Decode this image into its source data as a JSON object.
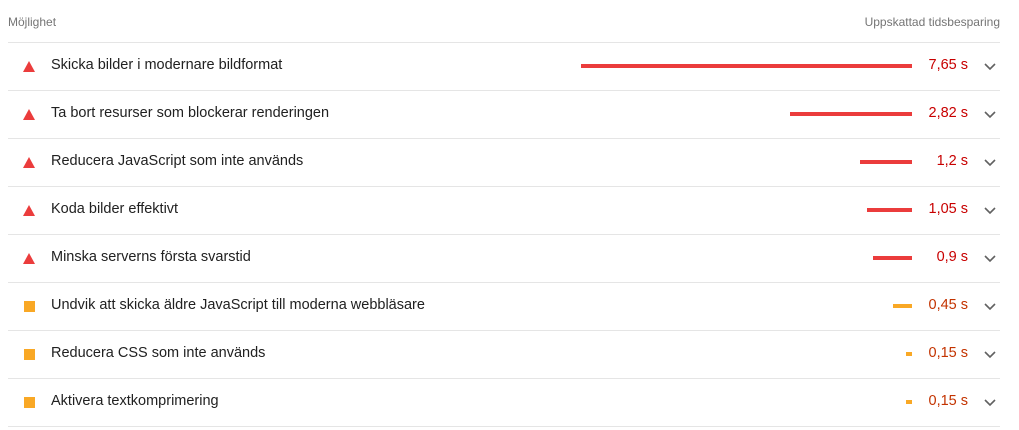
{
  "header": {
    "left_label": "Möjlighet",
    "right_label": "Uppskattad tidsbesparing"
  },
  "colors": {
    "fail": "#eb3c3c",
    "fail_text": "#c80000",
    "average": "#f9a825",
    "average_text": "#c33300"
  },
  "max_savings_seconds": 7.65,
  "opportunities": [
    {
      "title": "Skicka bilder i modernare bildformat",
      "savings": "7,65 s",
      "savings_seconds": 7.65,
      "status": "fail",
      "icon": "warning-triangle-icon"
    },
    {
      "title": "Ta bort resurser som blockerar renderingen",
      "savings": "2,82 s",
      "savings_seconds": 2.82,
      "status": "fail",
      "icon": "warning-triangle-icon"
    },
    {
      "title": "Reducera JavaScript som inte används",
      "savings": "1,2 s",
      "savings_seconds": 1.2,
      "status": "fail",
      "icon": "warning-triangle-icon"
    },
    {
      "title": "Koda bilder effektivt",
      "savings": "1,05 s",
      "savings_seconds": 1.05,
      "status": "fail",
      "icon": "warning-triangle-icon"
    },
    {
      "title": "Minska serverns första svarstid",
      "savings": "0,9 s",
      "savings_seconds": 0.9,
      "status": "fail",
      "icon": "warning-triangle-icon"
    },
    {
      "title": "Undvik att skicka äldre JavaScript till moderna webbläsare",
      "savings": "0,45 s",
      "savings_seconds": 0.45,
      "status": "average",
      "icon": "warning-square-icon"
    },
    {
      "title": "Reducera CSS som inte används",
      "savings": "0,15 s",
      "savings_seconds": 0.15,
      "status": "average",
      "icon": "warning-square-icon"
    },
    {
      "title": "Aktivera textkomprimering",
      "savings": "0,15 s",
      "savings_seconds": 0.15,
      "status": "average",
      "icon": "warning-square-icon"
    }
  ]
}
